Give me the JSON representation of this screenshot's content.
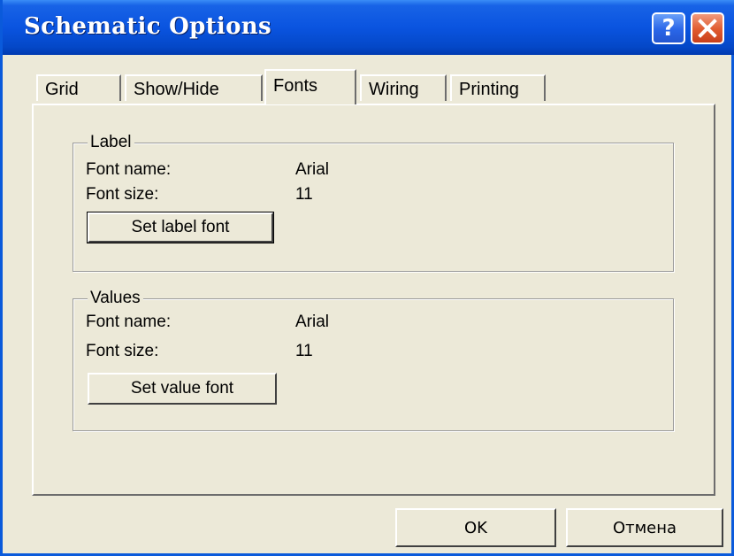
{
  "window": {
    "title": "Schematic Options"
  },
  "titlebar_buttons": {
    "help": "?",
    "close": "✕"
  },
  "tabs": [
    {
      "label": "Grid"
    },
    {
      "label": "Show/Hide"
    },
    {
      "label": "Fonts",
      "active": true
    },
    {
      "label": "Wiring"
    },
    {
      "label": "Printing"
    }
  ],
  "label_group": {
    "title": "Label",
    "font_name_label": "Font name:",
    "font_name_value": "Arial",
    "font_size_label": "Font size:",
    "font_size_value": "11",
    "button": "Set label font"
  },
  "values_group": {
    "title": "Values",
    "font_name_label": "Font name:",
    "font_name_value": "Arial",
    "font_size_label": "Font size:",
    "font_size_value": "11",
    "button": "Set value font"
  },
  "footer": {
    "ok": "OK",
    "cancel": "Отмена"
  },
  "colors": {
    "titlebar": "#0a54e0",
    "face": "#ece9d8",
    "close": "#e05a2e"
  },
  "icons": {
    "help": "help-icon",
    "close": "close-icon"
  }
}
